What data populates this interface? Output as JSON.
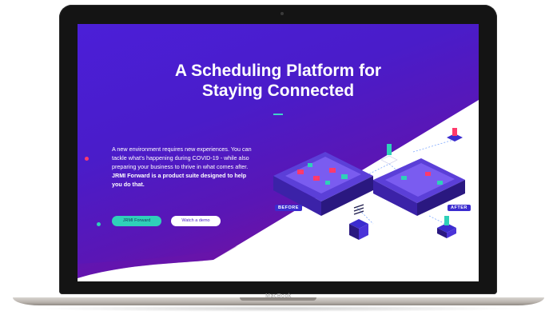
{
  "device": {
    "brand": "MacBook"
  },
  "hero": {
    "title_line1": "A Scheduling Platform for",
    "title_line2": "Staying Connected",
    "intro_text": "A new environment requires new experiences. You can tackle what’s happening during COVID-19 - while also preparing your business to thrive in what comes after. ",
    "intro_emphasis": "JRMI Forward is a product suite designed to help you do that.",
    "primary_button": "JRMI Forward",
    "secondary_button": "Watch a demo"
  },
  "illustration": {
    "before_label": "BEFORE",
    "after_label": "AFTER"
  },
  "colors": {
    "brand_purple": "#4b1fd8",
    "accent_teal": "#2fd0b9",
    "accent_magenta": "#8a0d8c",
    "accent_red": "#ff3a6c"
  }
}
